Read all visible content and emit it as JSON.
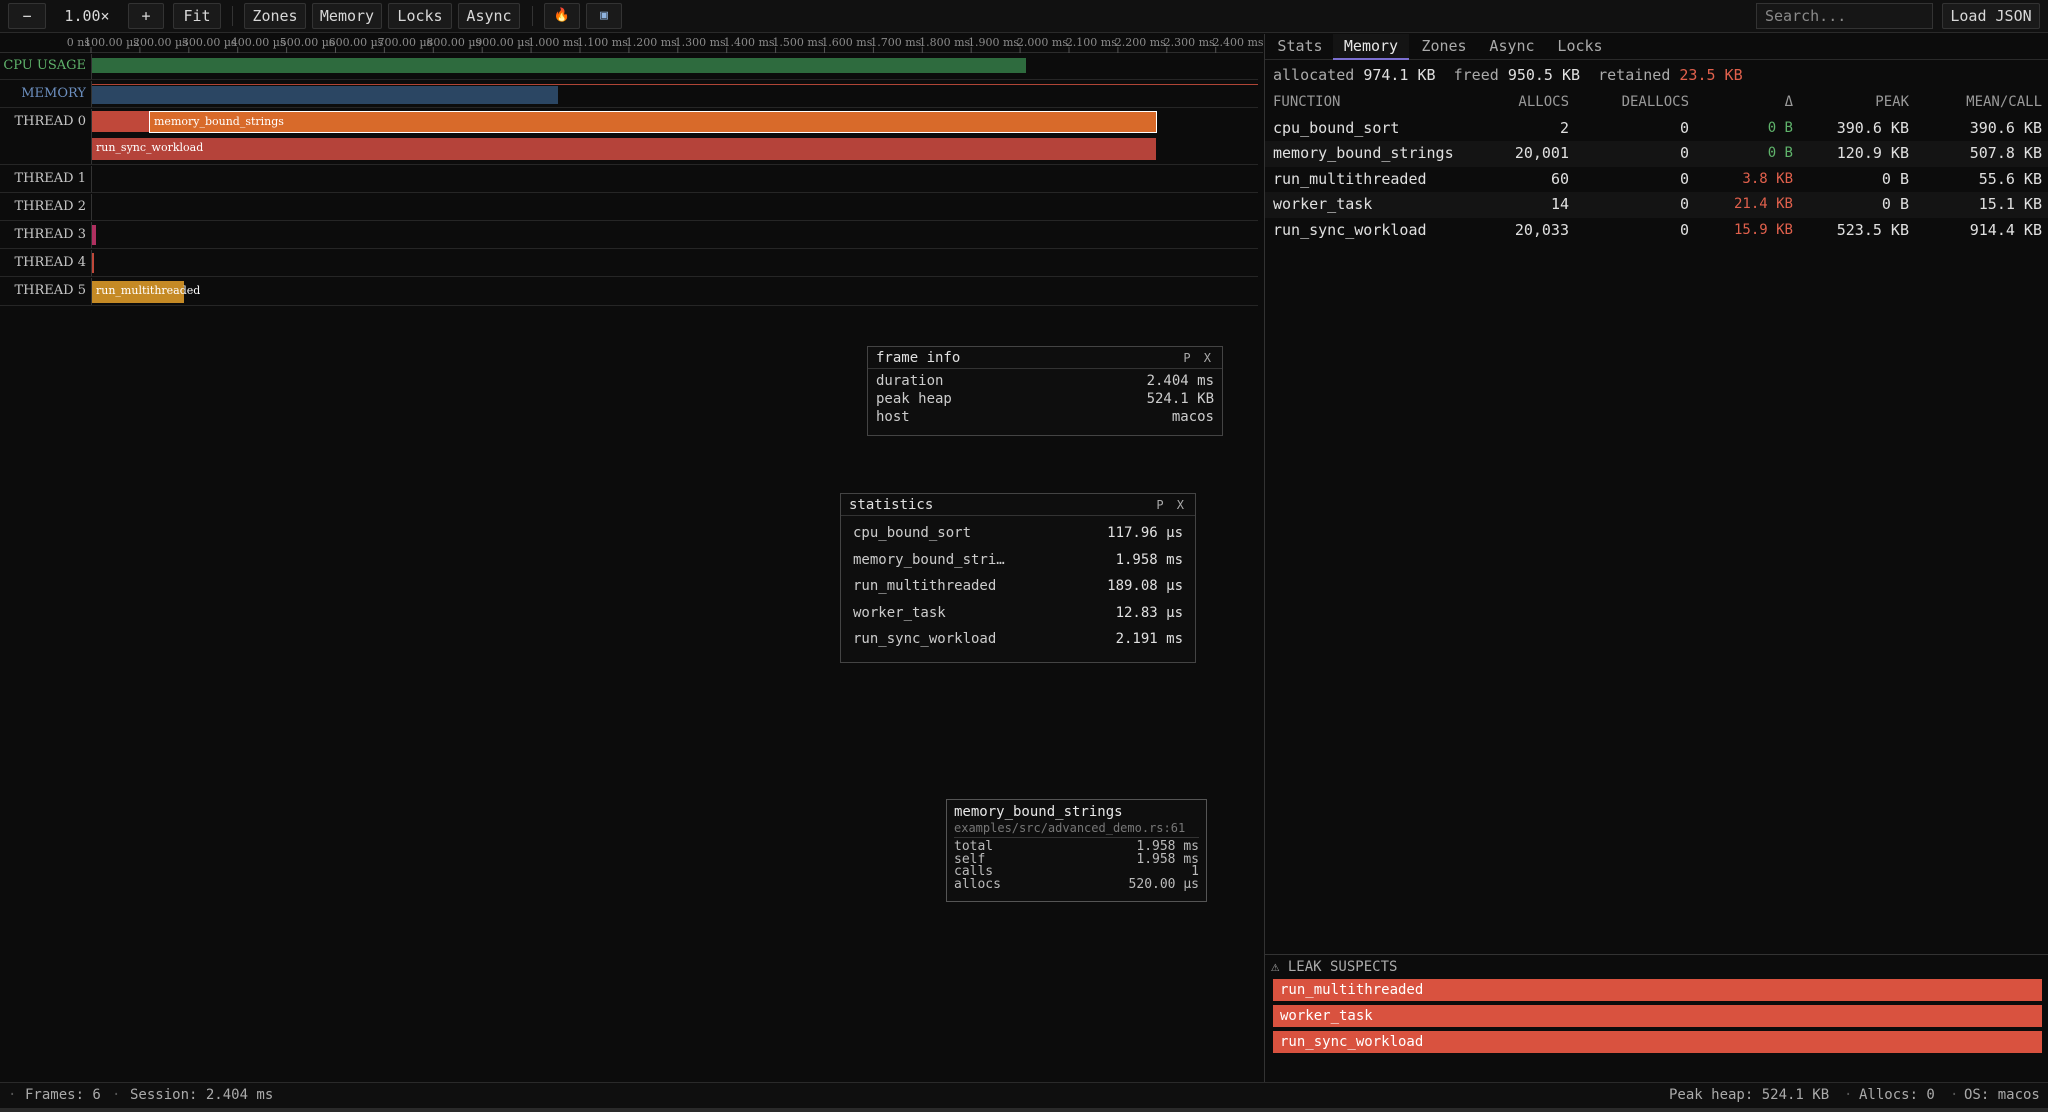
{
  "toolbar": {
    "zoom_out": "−",
    "zoom_level": "1.00×",
    "zoom_in": "+",
    "fit": "Fit",
    "zones": "Zones",
    "memory": "Memory",
    "locks": "Locks",
    "async": "Async",
    "flame_icon": "🔥",
    "screen_icon": "▣",
    "search_placeholder": "Search...",
    "load_json": "Load JSON"
  },
  "ruler_ticks": [
    "0 ns",
    "100.00 µs",
    "200.00 µs",
    "300.00 µs",
    "400.00 µs",
    "500.00 µs",
    "600.00 µs",
    "700.00 µs",
    "800.00 µs",
    "900.00 µs",
    "1.000 ms",
    "1.100 ms",
    "1.200 ms",
    "1.300 ms",
    "1.400 ms",
    "1.500 ms",
    "1.600 ms",
    "1.700 ms",
    "1.800 ms",
    "1.900 ms",
    "2.000 ms",
    "2.100 ms",
    "2.200 ms",
    "2.300 ms",
    "2.400 ms"
  ],
  "lanes": {
    "cpu": "CPU USAGE",
    "memory": "MEMORY",
    "thread0": "THREAD 0",
    "thread1": "THREAD 1",
    "thread2": "THREAD 2",
    "thread3": "THREAD 3",
    "thread4": "THREAD 4",
    "thread5": "THREAD 5"
  },
  "zones": {
    "memory_bound_strings": "memory_bound_strings",
    "run_sync_workload": "run_sync_workload",
    "run_multithreaded": "run_multithreaded"
  },
  "frame_info": {
    "title": "frame info",
    "controls": "P X",
    "rows": [
      {
        "k": "duration",
        "v": "2.404 ms"
      },
      {
        "k": "peak heap",
        "v": "524.1 KB"
      },
      {
        "k": "host",
        "v": "macos"
      }
    ]
  },
  "statistics": {
    "title": "statistics",
    "controls": "P X",
    "rows": [
      {
        "k": "cpu_bound_sort",
        "v": "117.96 µs"
      },
      {
        "k": "memory_bound_stri…",
        "v": "1.958 ms"
      },
      {
        "k": "run_multithreaded",
        "v": "189.08 µs"
      },
      {
        "k": "worker_task",
        "v": "12.83 µs"
      },
      {
        "k": "run_sync_workload",
        "v": "2.191 ms"
      }
    ]
  },
  "tooltip": {
    "name": "memory_bound_strings",
    "location": "examples/src/advanced_demo.rs:61",
    "rows": [
      {
        "k": "total",
        "v": "1.958 ms"
      },
      {
        "k": "self",
        "v": "1.958 ms"
      },
      {
        "k": "calls",
        "v": "1"
      },
      {
        "k": "allocs",
        "v": "520.00 µs"
      }
    ]
  },
  "tabs": [
    "Stats",
    "Memory",
    "Zones",
    "Async",
    "Locks"
  ],
  "memory_summary": {
    "allocated_label": "allocated",
    "allocated": "974.1 KB",
    "freed_label": "freed",
    "freed": "950.5 KB",
    "retained_label": "retained",
    "retained": "23.5 KB"
  },
  "table": {
    "headers": [
      "FUNCTION",
      "ALLOCS",
      "DEALLOCS",
      "Δ",
      "PEAK",
      "MEAN/CALL"
    ],
    "rows": [
      {
        "fn": "cpu_bound_sort",
        "allocs": "2",
        "deallocs": "0",
        "delta": "0 B",
        "peak": "390.6 KB",
        "mean": "390.6 KB"
      },
      {
        "fn": "memory_bound_strings",
        "allocs": "20,001",
        "deallocs": "0",
        "delta": "0 B",
        "peak": "120.9 KB",
        "mean": "507.8 KB"
      },
      {
        "fn": "run_multithreaded",
        "allocs": "60",
        "deallocs": "0",
        "delta": "3.8 KB",
        "peak": "0 B",
        "mean": "55.6 KB"
      },
      {
        "fn": "worker_task",
        "allocs": "14",
        "deallocs": "0",
        "delta": "21.4 KB",
        "peak": "0 B",
        "mean": "15.1 KB"
      },
      {
        "fn": "run_sync_workload",
        "allocs": "20,033",
        "deallocs": "0",
        "delta": "15.9 KB",
        "peak": "523.5 KB",
        "mean": "914.4 KB"
      }
    ]
  },
  "leaks": {
    "title": "⚠ LEAK SUSPECTS",
    "items": [
      "run_multithreaded",
      "worker_task",
      "run_sync_workload"
    ]
  },
  "status": {
    "frames": "Frames: 6",
    "session": "Session: 2.404 ms",
    "peak_heap": "Peak heap: 524.1 KB",
    "allocs": "Allocs: 0",
    "os": "OS: macos",
    "sep": "·"
  },
  "colors": {
    "cpu_bar": "#2e6b3e",
    "memory_bar": "#2b4663",
    "thread0_bar": "#c0483a",
    "zone_orange": "#d86a2a",
    "zone_gold": "#c58a25",
    "leak_bg": "#d9523f",
    "delta_green": "#5fb36b",
    "delta_red": "#e0604c",
    "tab_accent": "#7b6fd0"
  }
}
